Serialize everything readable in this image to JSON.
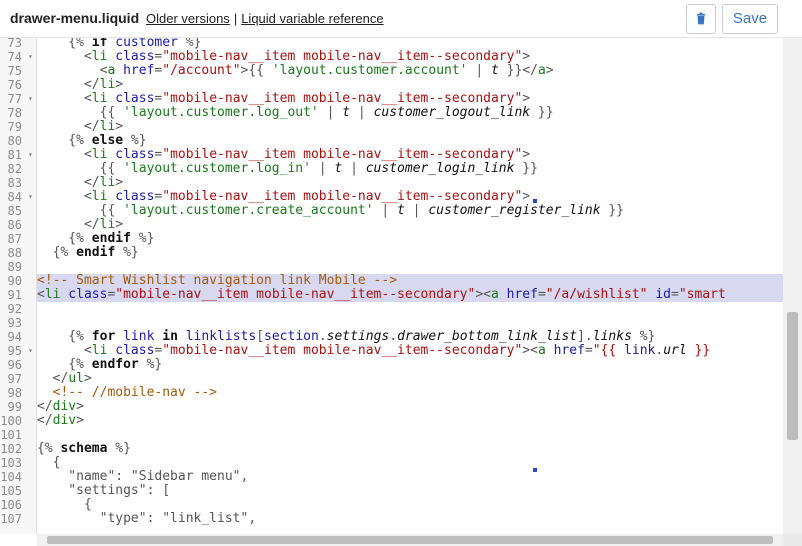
{
  "header": {
    "file_name": "drawer-menu.liquid",
    "older_versions_link": "Older versions",
    "separator": "|",
    "variable_reference_link": "Liquid variable reference",
    "delete_icon": "trash-icon",
    "save_label": "Save"
  },
  "lines": [
    {
      "num": "73",
      "fold": false,
      "hl": false,
      "segs": [
        [
          "t",
          "    {"
        ],
        [
          "t",
          "% "
        ],
        [
          "k",
          "if"
        ],
        [
          "v",
          " customer"
        ],
        [
          "t",
          " %}"
        ]
      ]
    },
    {
      "num": "74",
      "fold": true,
      "hl": false,
      "segs": [
        [
          "t",
          "      <"
        ],
        [
          "g",
          "li"
        ],
        [
          "a",
          " class"
        ],
        [
          "t",
          "="
        ],
        [
          "as",
          "\"mobile-nav__item mobile-nav__item--secondary\""
        ],
        [
          "t",
          ">"
        ]
      ]
    },
    {
      "num": "75",
      "fold": false,
      "hl": false,
      "segs": [
        [
          "t",
          "        <"
        ],
        [
          "g",
          "a"
        ],
        [
          "a",
          " href"
        ],
        [
          "t",
          "="
        ],
        [
          "as",
          "\"/account\""
        ],
        [
          "t",
          ">{{ "
        ],
        [
          "s",
          "'layout.customer.account'"
        ],
        [
          "t",
          " | "
        ],
        [
          "f",
          "t"
        ],
        [
          "t",
          " }}</"
        ],
        [
          "g",
          "a"
        ],
        [
          "t",
          ">"
        ]
      ]
    },
    {
      "num": "76",
      "fold": false,
      "hl": false,
      "segs": [
        [
          "t",
          "      </"
        ],
        [
          "g",
          "li"
        ],
        [
          "t",
          ">"
        ]
      ]
    },
    {
      "num": "77",
      "fold": true,
      "hl": false,
      "segs": [
        [
          "t",
          "      <"
        ],
        [
          "g",
          "li"
        ],
        [
          "a",
          " class"
        ],
        [
          "t",
          "="
        ],
        [
          "as",
          "\"mobile-nav__item mobile-nav__item--secondary\""
        ],
        [
          "t",
          ">"
        ]
      ]
    },
    {
      "num": "78",
      "fold": false,
      "hl": false,
      "segs": [
        [
          "t",
          "        {{ "
        ],
        [
          "s",
          "'layout.customer.log_out'"
        ],
        [
          "t",
          " | "
        ],
        [
          "f",
          "t"
        ],
        [
          "t",
          " | "
        ],
        [
          "f",
          "customer_logout_link"
        ],
        [
          "t",
          " }}"
        ]
      ]
    },
    {
      "num": "79",
      "fold": false,
      "hl": false,
      "segs": [
        [
          "t",
          "      </"
        ],
        [
          "g",
          "li"
        ],
        [
          "t",
          ">"
        ]
      ]
    },
    {
      "num": "80",
      "fold": false,
      "hl": false,
      "segs": [
        [
          "t",
          "    {% "
        ],
        [
          "k",
          "else"
        ],
        [
          "t",
          " %}"
        ]
      ]
    },
    {
      "num": "81",
      "fold": true,
      "hl": false,
      "segs": [
        [
          "t",
          "      <"
        ],
        [
          "g",
          "li"
        ],
        [
          "a",
          " class"
        ],
        [
          "t",
          "="
        ],
        [
          "as",
          "\"mobile-nav__item mobile-nav__item--secondary\""
        ],
        [
          "t",
          ">"
        ]
      ]
    },
    {
      "num": "82",
      "fold": false,
      "hl": false,
      "segs": [
        [
          "t",
          "        {{ "
        ],
        [
          "s",
          "'layout.customer.log_in'"
        ],
        [
          "t",
          " | "
        ],
        [
          "f",
          "t"
        ],
        [
          "t",
          " | "
        ],
        [
          "f",
          "customer_login_link"
        ],
        [
          "t",
          " }}"
        ]
      ]
    },
    {
      "num": "83",
      "fold": false,
      "hl": false,
      "segs": [
        [
          "t",
          "      </"
        ],
        [
          "g",
          "li"
        ],
        [
          "t",
          ">"
        ]
      ]
    },
    {
      "num": "84",
      "fold": true,
      "hl": false,
      "segs": [
        [
          "t",
          "      <"
        ],
        [
          "g",
          "li"
        ],
        [
          "a",
          " class"
        ],
        [
          "t",
          "="
        ],
        [
          "as",
          "\"mobile-nav__item mobile-nav__item--secondary\""
        ],
        [
          "t",
          ">"
        ]
      ]
    },
    {
      "num": "85",
      "fold": false,
      "hl": false,
      "segs": [
        [
          "t",
          "        {{ "
        ],
        [
          "s",
          "'layout.customer.create_account'"
        ],
        [
          "t",
          " | "
        ],
        [
          "f",
          "t"
        ],
        [
          "t",
          " | "
        ],
        [
          "f",
          "customer_register_link"
        ],
        [
          "t",
          " }}"
        ]
      ]
    },
    {
      "num": "86",
      "fold": false,
      "hl": false,
      "segs": [
        [
          "t",
          "      </"
        ],
        [
          "g",
          "li"
        ],
        [
          "t",
          ">"
        ]
      ]
    },
    {
      "num": "87",
      "fold": false,
      "hl": false,
      "segs": [
        [
          "t",
          "    {% "
        ],
        [
          "k",
          "endif"
        ],
        [
          "t",
          " %}"
        ]
      ]
    },
    {
      "num": "88",
      "fold": false,
      "hl": false,
      "segs": [
        [
          "t",
          "  {% "
        ],
        [
          "k",
          "endif"
        ],
        [
          "t",
          " %}"
        ]
      ]
    },
    {
      "num": "89",
      "fold": false,
      "hl": false,
      "segs": []
    },
    {
      "num": "90",
      "fold": false,
      "hl": true,
      "segs": [
        [
          "c",
          "<!-- Smart Wishlist navigation link Mobile -->"
        ]
      ]
    },
    {
      "num": "91",
      "fold": false,
      "hl": true,
      "segs": [
        [
          "t",
          "<"
        ],
        [
          "g",
          "li"
        ],
        [
          "a",
          " class"
        ],
        [
          "t",
          "="
        ],
        [
          "as",
          "\"mobile-nav__item mobile-nav__item--secondary\""
        ],
        [
          "t",
          ">"
        ],
        [
          "t",
          "<"
        ],
        [
          "g",
          "a"
        ],
        [
          "a",
          " href"
        ],
        [
          "t",
          "="
        ],
        [
          "as",
          "\"/a/wishlist\""
        ],
        [
          "a",
          " id"
        ],
        [
          "t",
          "="
        ],
        [
          "as",
          "\"smart"
        ]
      ]
    },
    {
      "num": "92",
      "fold": false,
      "hl": false,
      "segs": []
    },
    {
      "num": "93",
      "fold": false,
      "hl": false,
      "segs": []
    },
    {
      "num": "94",
      "fold": false,
      "hl": false,
      "segs": [
        [
          "t",
          "    {% "
        ],
        [
          "k",
          "for"
        ],
        [
          "v",
          " link"
        ],
        [
          "k",
          " in"
        ],
        [
          "v",
          " linklists"
        ],
        [
          "t",
          "["
        ],
        [
          "v",
          "section"
        ],
        [
          "t",
          "."
        ],
        [
          "f",
          "settings"
        ],
        [
          "t",
          "."
        ],
        [
          "f",
          "drawer_bottom_link_list"
        ],
        [
          "t",
          "]."
        ],
        [
          "f",
          "links"
        ],
        [
          "t",
          " %}"
        ]
      ]
    },
    {
      "num": "95",
      "fold": true,
      "hl": false,
      "segs": [
        [
          "t",
          "      <"
        ],
        [
          "g",
          "li"
        ],
        [
          "a",
          " class"
        ],
        [
          "t",
          "="
        ],
        [
          "as",
          "\"mobile-nav__item mobile-nav__item--secondary\""
        ],
        [
          "t",
          ">"
        ],
        [
          "t",
          "<"
        ],
        [
          "g",
          "a"
        ],
        [
          "a",
          " href"
        ],
        [
          "t",
          "="
        ],
        [
          "as",
          "\"{{ "
        ],
        [
          "v",
          "link"
        ],
        [
          "t",
          "."
        ],
        [
          "f",
          "url"
        ],
        [
          "as",
          " }}"
        ]
      ]
    },
    {
      "num": "96",
      "fold": false,
      "hl": false,
      "segs": [
        [
          "t",
          "    {% "
        ],
        [
          "k",
          "endfor"
        ],
        [
          "t",
          " %}"
        ]
      ]
    },
    {
      "num": "97",
      "fold": false,
      "hl": false,
      "segs": [
        [
          "t",
          "  </"
        ],
        [
          "g",
          "ul"
        ],
        [
          "t",
          ">"
        ]
      ]
    },
    {
      "num": "98",
      "fold": false,
      "hl": false,
      "segs": [
        [
          "c",
          "  <!-- //mobile-nav -->"
        ]
      ]
    },
    {
      "num": "99",
      "fold": false,
      "hl": false,
      "segs": [
        [
          "t",
          "</"
        ],
        [
          "g",
          "div"
        ],
        [
          "t",
          ">"
        ]
      ]
    },
    {
      "num": "100",
      "fold": false,
      "hl": false,
      "segs": [
        [
          "t",
          "</"
        ],
        [
          "g",
          "div"
        ],
        [
          "t",
          ">"
        ]
      ]
    },
    {
      "num": "101",
      "fold": false,
      "hl": false,
      "segs": []
    },
    {
      "num": "102",
      "fold": false,
      "hl": false,
      "segs": [
        [
          "t",
          "{% "
        ],
        [
          "k",
          "schema"
        ],
        [
          "t",
          " %}"
        ]
      ]
    },
    {
      "num": "103",
      "fold": false,
      "hl": false,
      "segs": [
        [
          "t",
          "  {"
        ]
      ]
    },
    {
      "num": "104",
      "fold": false,
      "hl": false,
      "segs": [
        [
          "t",
          "    \"name\": \"Sidebar menu\","
        ]
      ]
    },
    {
      "num": "105",
      "fold": false,
      "hl": false,
      "segs": [
        [
          "t",
          "    \"settings\": ["
        ]
      ]
    },
    {
      "num": "106",
      "fold": false,
      "hl": false,
      "segs": [
        [
          "t",
          "      {"
        ]
      ]
    },
    {
      "num": "107",
      "fold": false,
      "hl": false,
      "segs": [
        [
          "t",
          "        \"type\": \"link_list\","
        ]
      ]
    }
  ]
}
